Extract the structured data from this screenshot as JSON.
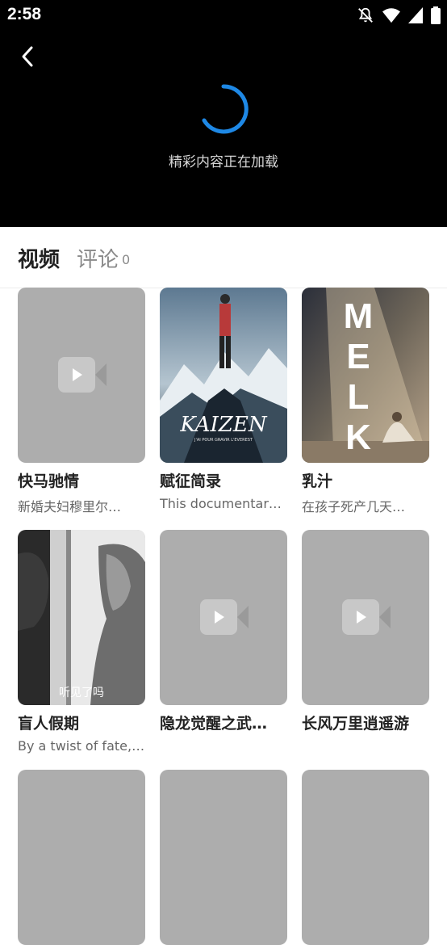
{
  "status_bar": {
    "time": "2:58"
  },
  "player": {
    "loading_text": "精彩内容正在加载"
  },
  "tabs": {
    "video": "视频",
    "comment": "评论",
    "comment_count": "0"
  },
  "videos": [
    {
      "title": "快马驰情",
      "desc": "新婚夫妇穆里尔…"
    },
    {
      "title": "赋征简录",
      "desc": "This documentary…"
    },
    {
      "title": "乳汁",
      "desc": "在孩子死产几天…"
    },
    {
      "title": "盲人假期",
      "desc": "By a twist of fate, …"
    },
    {
      "title": "隐龙觉醒之武…",
      "desc": ""
    },
    {
      "title": "长风万里逍遥游",
      "desc": ""
    }
  ],
  "posters": {
    "kaizen_logo": "KAIZEN",
    "kaizen_tagline": "J'AI POUR GRAVIR L'EVEREST",
    "melk_title": "MELK",
    "blind_subtitle": "听见了吗"
  }
}
